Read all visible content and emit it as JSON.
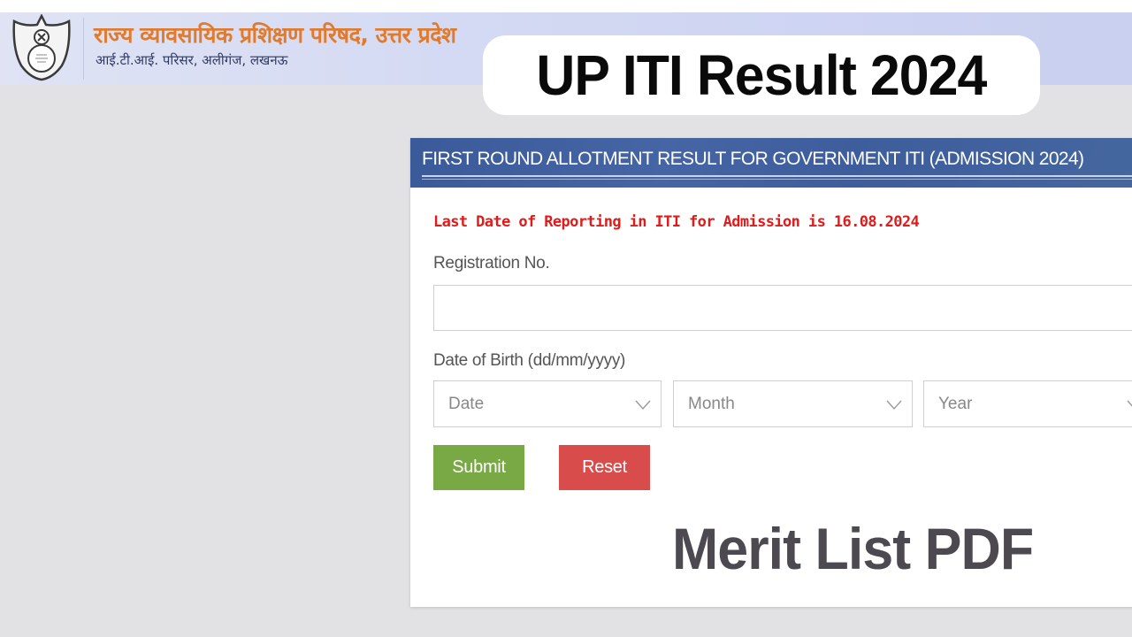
{
  "header": {
    "org_name": "राज्य व्यावसायिक प्रशिक्षण परिषद, उत्तर प्रदेश",
    "org_address": "आई.टी.आई. परिसर, अलीगंज, लखनऊ",
    "logo_icon": "emblem-shield-icon"
  },
  "banner": {
    "title": "UP ITI Result 2024",
    "subtitle": "Merit List PDF"
  },
  "panel": {
    "title": "FIRST ROUND ALLOTMENT RESULT FOR GOVERNMENT ITI (ADMISSION 2024)",
    "notice": "Last Date of Reporting in ITI for Admission is 16.08.2024",
    "registration_label": "Registration No.",
    "registration_value": "",
    "dob_label": "Date of Birth (dd/mm/yyyy)",
    "selects": {
      "date": "Date",
      "month": "Month",
      "year": "Year"
    },
    "buttons": {
      "submit": "Submit",
      "reset": "Reset"
    }
  },
  "colors": {
    "notice_red": "#e01b1b",
    "panel_header_blue": "#3d5d9c",
    "submit_green": "#78a944",
    "reset_red": "#d94c4c",
    "org_orange": "#e07b2e"
  }
}
